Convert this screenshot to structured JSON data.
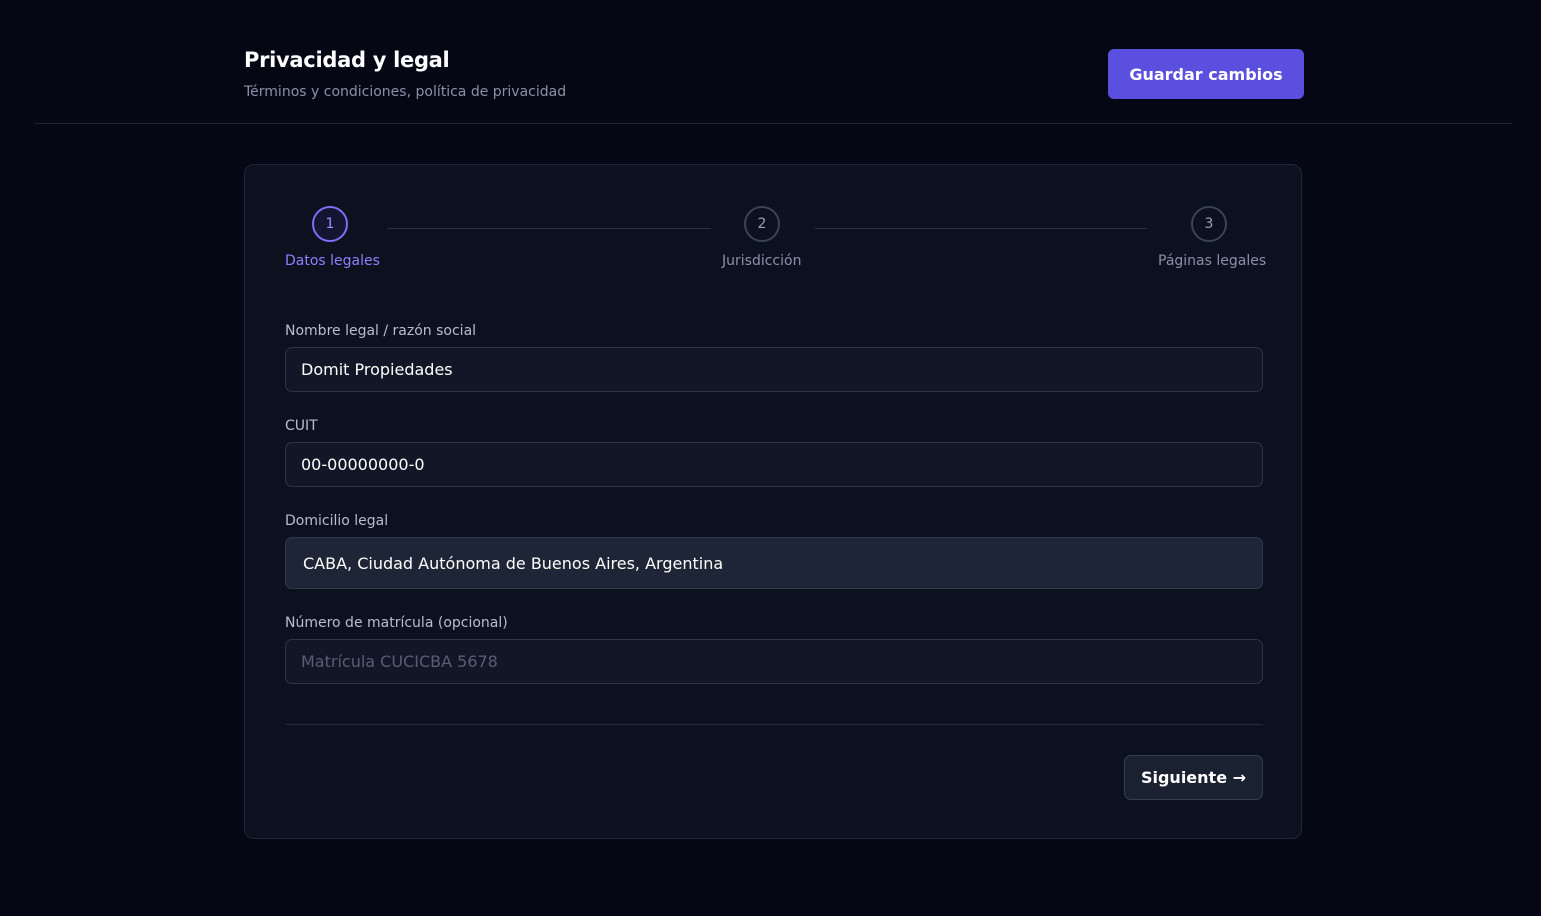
{
  "header": {
    "title": "Privacidad y legal",
    "subtitle": "Términos y condiciones, política de privacidad",
    "save_label": "Guardar cambios"
  },
  "stepper": {
    "steps": [
      {
        "number": "1",
        "label": "Datos legales",
        "active": true
      },
      {
        "number": "2",
        "label": "Jurisdicción",
        "active": false
      },
      {
        "number": "3",
        "label": "Páginas legales",
        "active": false
      }
    ]
  },
  "form": {
    "legal_name": {
      "label": "Nombre legal / razón social",
      "value": "Domit Propiedades"
    },
    "cuit": {
      "label": "CUIT",
      "value": "00-00000000-0"
    },
    "address": {
      "label": "Domicilio legal",
      "value": "CABA, Ciudad Autónoma de Buenos Aires, Argentina"
    },
    "license": {
      "label": "Número de matrícula (opcional)",
      "value": "",
      "placeholder": "Matrícula CUCICBA 5678"
    }
  },
  "footer": {
    "next_label": "Siguiente →"
  },
  "colors": {
    "background": "#050814",
    "accent": "#5b4fe0",
    "card": "#0c1120",
    "active_step": "#8b80ff"
  }
}
